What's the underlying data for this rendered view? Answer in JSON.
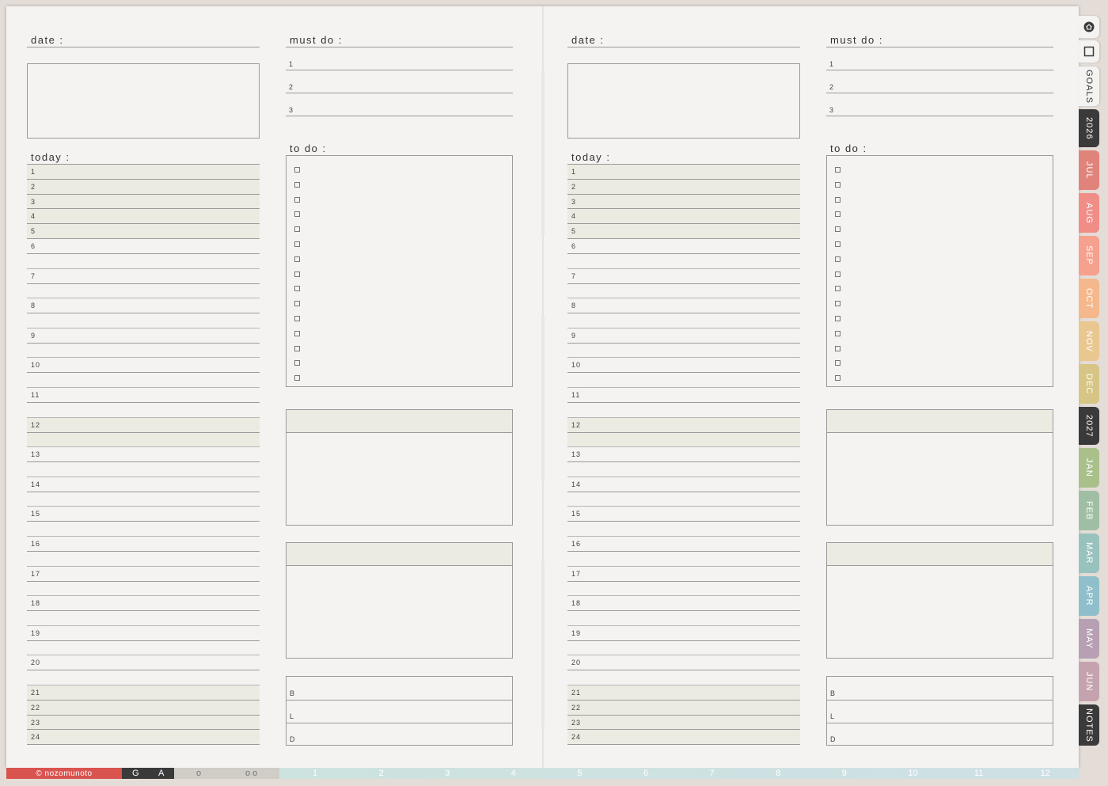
{
  "labels": {
    "date": "date :",
    "must_do": "must do :",
    "today": "today :",
    "to_do": "to do :"
  },
  "must_do_numbers": [
    "1",
    "2",
    "3"
  ],
  "hours": [
    "1",
    "2",
    "3",
    "4",
    "5",
    "6",
    "7",
    "8",
    "9",
    "10",
    "11",
    "12",
    "13",
    "14",
    "15",
    "16",
    "17",
    "18",
    "19",
    "20",
    "21",
    "22",
    "23",
    "24"
  ],
  "meals": [
    "B",
    "L",
    "D"
  ],
  "tabs": [
    {
      "label": "GOALS",
      "color": "#f4f3f1",
      "text": "#333333"
    },
    {
      "label": "2026",
      "color": "#3a3a3a",
      "text": "#ffffff"
    },
    {
      "label": "JUL",
      "color": "#e0837a",
      "text": "#ffffff"
    },
    {
      "label": "AUG",
      "color": "#f08d87",
      "text": "#ffffff"
    },
    {
      "label": "SEP",
      "color": "#f6a08e",
      "text": "#ffffff"
    },
    {
      "label": "OCT",
      "color": "#f4b88c",
      "text": "#ffffff"
    },
    {
      "label": "NOV",
      "color": "#e9c790",
      "text": "#ffffff"
    },
    {
      "label": "DEC",
      "color": "#d6c585",
      "text": "#ffffff"
    },
    {
      "label": "2027",
      "color": "#3a3a3a",
      "text": "#ffffff"
    },
    {
      "label": "JAN",
      "color": "#a9c08a",
      "text": "#ffffff"
    },
    {
      "label": "FEB",
      "color": "#9fbea3",
      "text": "#ffffff"
    },
    {
      "label": "MAR",
      "color": "#98c2bd",
      "text": "#ffffff"
    },
    {
      "label": "APR",
      "color": "#8fbfca",
      "text": "#ffffff"
    },
    {
      "label": "MAY",
      "color": "#b7a0b3",
      "text": "#ffffff"
    },
    {
      "label": "JUN",
      "color": "#c5a3ae",
      "text": "#ffffff"
    },
    {
      "label": "NOTES",
      "color": "#3a3a3a",
      "text": "#ffffff"
    }
  ],
  "bottom_bar": {
    "brand": "© nozomunoto",
    "brand_color": "#d9534f",
    "g": "G",
    "a": "A",
    "o1": "o",
    "o2": "o o",
    "months": [
      "1",
      "2",
      "3",
      "4",
      "5",
      "6",
      "7",
      "8",
      "9",
      "10",
      "11",
      "12"
    ]
  },
  "colors": {
    "paper": "#f4f3f1",
    "shade": "#ecebe2",
    "line": "#9a9a9a"
  }
}
